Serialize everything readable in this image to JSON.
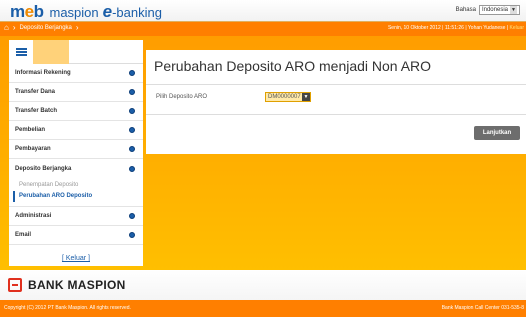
{
  "header": {
    "logo_text": "m",
    "logo_dot": "e",
    "logo_tail": "b",
    "brand_name": "maspion",
    "brand_e": "e",
    "brand_suffix": "-banking",
    "lang_label": "Bahasa",
    "lang_value": "Indonesia"
  },
  "navbar": {
    "breadcrumb": "Deposito Berjangka",
    "date_time": "Senin, 10 Oktober 2012 | 11:51:26 | Yohan Yudanese |",
    "exit_label": "Keluar"
  },
  "sidebar": {
    "items": [
      {
        "label": "Informasi Rekening"
      },
      {
        "label": "Transfer Dana"
      },
      {
        "label": "Transfer Batch"
      },
      {
        "label": "Pembelian"
      },
      {
        "label": "Pembayaran"
      },
      {
        "label": "Deposito Berjangka"
      }
    ],
    "submenu": [
      {
        "label": "Penempatan Deposito"
      },
      {
        "label": "Perubahan ARO Deposito"
      }
    ],
    "items_after": [
      {
        "label": "Administrasi"
      },
      {
        "label": "Email"
      }
    ],
    "logout_label": "[ Keluar ]"
  },
  "main": {
    "title": "Perubahan Deposito ARO menjadi Non ARO",
    "field_label": "Pilih Deposito ARO",
    "field_value": "DM0000007",
    "next_button": "Lanjutkan"
  },
  "bank": {
    "name": "BANK MASPION"
  },
  "footer": {
    "copyright": "Copyright (C) 2012 PT Bank Maspion. All rights reserved.",
    "call_center": "Bank Maspion Call Center 031-535-8"
  },
  "colors": {
    "brand_blue": "#1b5ea8",
    "orange": "#ff7f00",
    "button_grey": "#6d6d6d"
  }
}
